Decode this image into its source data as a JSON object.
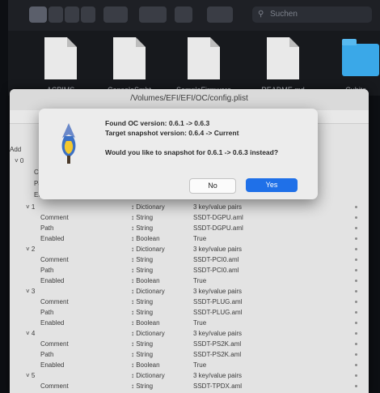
{
  "finder": {
    "search_placeholder": "Suchen",
    "files": [
      {
        "name": "ACPIMS"
      },
      {
        "name": "ConsoleSmbt"
      },
      {
        "name": "SampleFirmware"
      },
      {
        "name": "README.md"
      },
      {
        "name": "Cubits"
      }
    ]
  },
  "editor": {
    "title": "/Volumes/EFI/EFI/OC/config.plist",
    "rows": [
      {
        "key": "˅ 1",
        "type": "↕ Dictionary",
        "value": "3 key/value pairs"
      },
      {
        "key": "Comment",
        "type": "↕ String",
        "value": "SSDT-DGPU.aml"
      },
      {
        "key": "Path",
        "type": "↕ String",
        "value": "SSDT-DGPU.aml"
      },
      {
        "key": "Enabled",
        "type": "↕ Boolean",
        "value": "True"
      },
      {
        "key": "˅ 2",
        "type": "↕ Dictionary",
        "value": "3 key/value pairs"
      },
      {
        "key": "Comment",
        "type": "↕ String",
        "value": "SSDT-PCI0.aml"
      },
      {
        "key": "Path",
        "type": "↕ String",
        "value": "SSDT-PCI0.aml"
      },
      {
        "key": "Enabled",
        "type": "↕ Boolean",
        "value": "True"
      },
      {
        "key": "˅ 3",
        "type": "↕ Dictionary",
        "value": "3 key/value pairs"
      },
      {
        "key": "Comment",
        "type": "↕ String",
        "value": "SSDT-PLUG.aml"
      },
      {
        "key": "Path",
        "type": "↕ String",
        "value": "SSDT-PLUG.aml"
      },
      {
        "key": "Enabled",
        "type": "↕ Boolean",
        "value": "True"
      },
      {
        "key": "˅ 4",
        "type": "↕ Dictionary",
        "value": "3 key/value pairs"
      },
      {
        "key": "Comment",
        "type": "↕ String",
        "value": "SSDT-PS2K.aml"
      },
      {
        "key": "Path",
        "type": "↕ String",
        "value": "SSDT-PS2K.aml"
      },
      {
        "key": "Enabled",
        "type": "↕ Boolean",
        "value": "True"
      },
      {
        "key": "˅ 5",
        "type": "↕ Dictionary",
        "value": "3 key/value pairs"
      },
      {
        "key": "Comment",
        "type": "↕ String",
        "value": "SSDT-TPDX.aml"
      }
    ],
    "partial_keys": [
      "Add",
      "˅ 0",
      "Co",
      "Pa",
      "En"
    ]
  },
  "dialog": {
    "line1": "Found OC version: 0.6.1 -> 0.6.3",
    "line2": "Target snapshot version: 0.6.4 -> Current",
    "question": "Would you like to snapshot for 0.6.1 -> 0.6.3 instead?",
    "no_label": "No",
    "yes_label": "Yes"
  },
  "colors": {
    "accent": "#1f70e8",
    "folder": "#3aa8e8"
  }
}
